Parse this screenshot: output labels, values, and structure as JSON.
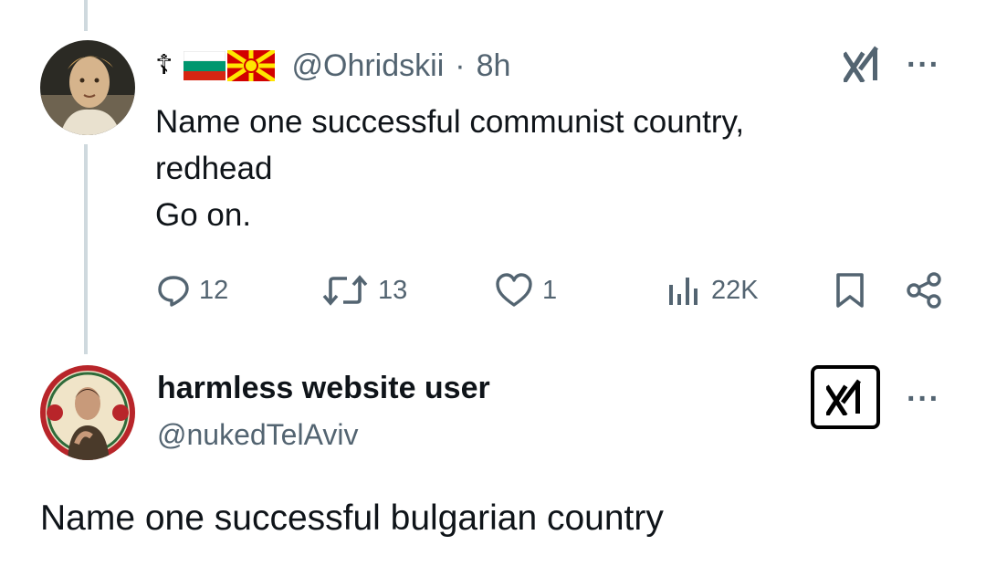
{
  "tweet": {
    "name_prefix": "☦",
    "flags": [
      "bulgaria-flag",
      "north-macedonia-flag"
    ],
    "handle": "@Ohridskii",
    "separator": "·",
    "time": "8h",
    "text_lines": [
      "Name one successful communist country,",
      "redhead",
      "Go on."
    ],
    "actions": {
      "replies": "12",
      "reposts": "13",
      "likes": "1",
      "views": "22K"
    },
    "icons": [
      "reply-icon",
      "repost-icon",
      "like-icon",
      "views-icon",
      "bookmark-icon",
      "share-icon",
      "xai-logo-icon",
      "more-icon"
    ]
  },
  "reply": {
    "name": "harmless website user",
    "handle": "@nukedTelAviv",
    "text": "Name one successful bulgarian country",
    "icons": [
      "xai-logo-icon",
      "more-icon"
    ]
  },
  "more_label": "···",
  "colors": {
    "text": "#0f1419",
    "secondary": "#536471",
    "thread_line": "#cfd9de"
  }
}
